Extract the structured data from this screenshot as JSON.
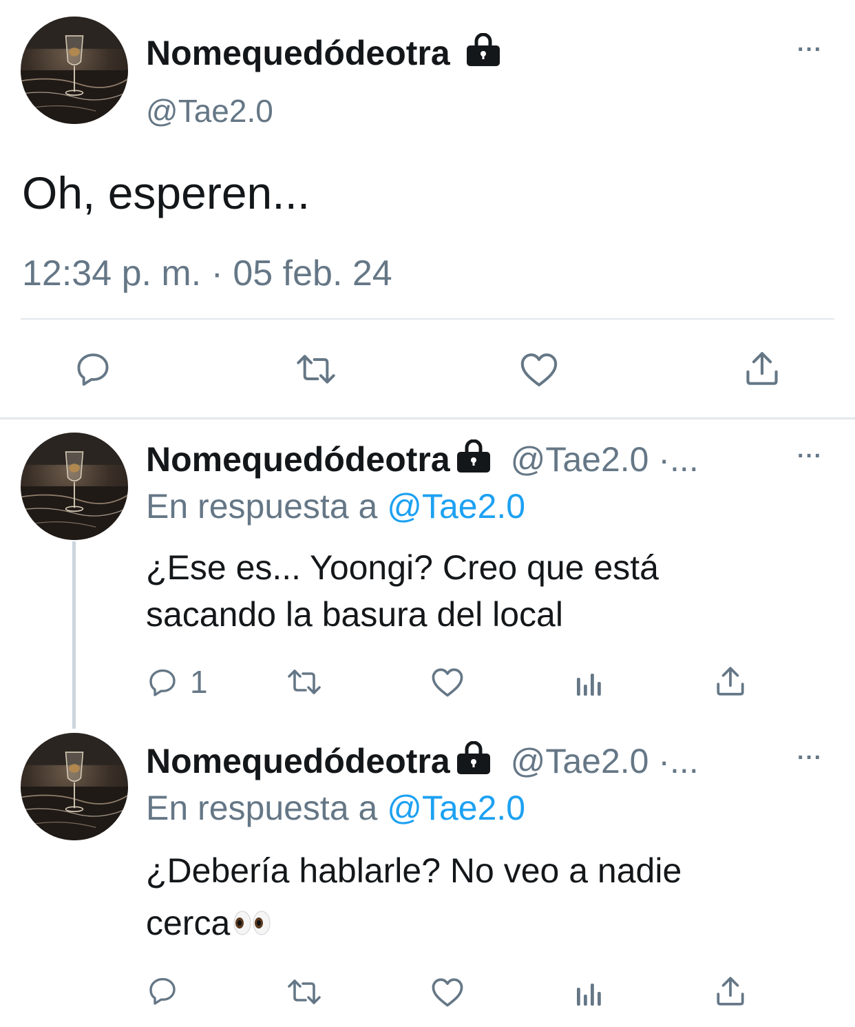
{
  "main_tweet": {
    "display_name": "Nomequedódeotra",
    "handle": "@Tae2.0",
    "text": "Oh, esperen...",
    "timestamp": "12:34 p. m. · 05 feb. 24",
    "more_label": "···",
    "actions": [
      "reply-icon",
      "retweet-icon",
      "like-icon",
      "share-icon"
    ]
  },
  "replies": [
    {
      "display_name": "Nomequedódeotra",
      "handle": "@Tae2.0",
      "truncation": " ·...",
      "reply_prefix": "En respuesta a",
      "reply_to": "@Tae2.0",
      "text_line1": "¿Ese es... Yoongi? Creo que está",
      "text_line2": "sacando la basura del local",
      "reply_count": "1",
      "more_label": "···"
    },
    {
      "display_name": "Nomequedódeotra",
      "handle": "@Tae2.0",
      "truncation": " ·...",
      "reply_prefix": "En respuesta a",
      "reply_to": "@Tae2.0",
      "text_line1": "¿Debería hablarle? No veo a nadie",
      "text_line2": "cerca",
      "emoji": "👀",
      "reply_count": "",
      "more_label": "···"
    }
  ],
  "colors": {
    "text": "#14171a",
    "muted": "#657786",
    "link": "#1da1f2",
    "divider": "#e1e8ed"
  }
}
